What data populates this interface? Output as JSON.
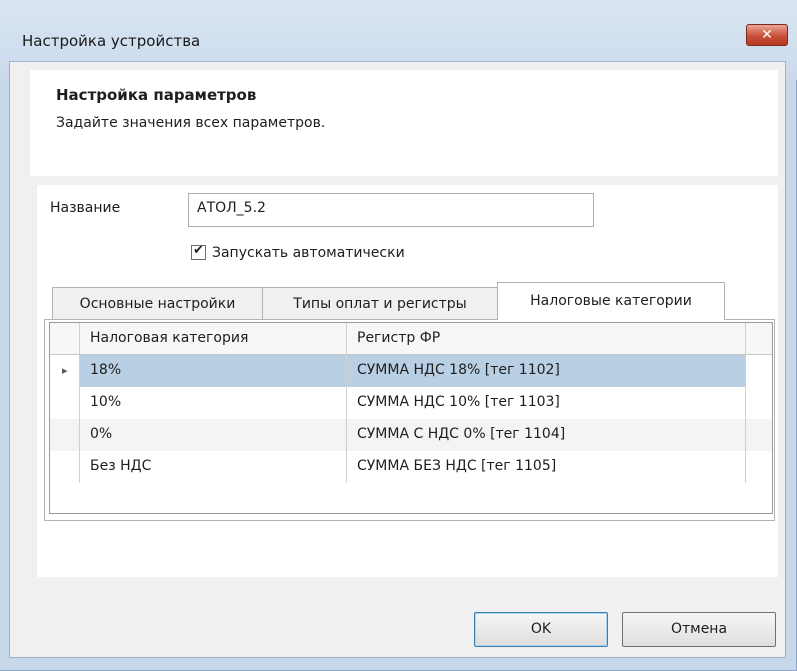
{
  "window": {
    "title": "Настройка устройства",
    "close_symbol": "✕"
  },
  "header": {
    "title": "Настройка параметров",
    "subtitle": "Задайте значения всех параметров."
  },
  "form": {
    "name_label": "Название",
    "name_value": "АТОЛ_5.2",
    "autostart_label": "Запускать автоматически",
    "autostart_checked": true
  },
  "tabs": [
    {
      "label": "Основные настройки",
      "active": false
    },
    {
      "label": "Типы оплат и регистры",
      "active": false
    },
    {
      "label": "Налоговые категории",
      "active": true
    }
  ],
  "grid": {
    "columns": [
      "Налоговая категория",
      "Регистр ФР"
    ],
    "rows": [
      {
        "category": "18%",
        "register": "СУММА НДС 18% [тег 1102]",
        "selected": true
      },
      {
        "category": "10%",
        "register": "СУММА НДС 10% [тег 1103]",
        "selected": false
      },
      {
        "category": "0%",
        "register": "СУММА С НДС 0% [тег 1104]",
        "selected": false
      },
      {
        "category": "Без НДС",
        "register": "СУММА БЕЗ НДС [тег 1105]",
        "selected": false
      }
    ],
    "row_indicator": "▸"
  },
  "buttons": {
    "ok": "OK",
    "cancel": "Отмена"
  }
}
